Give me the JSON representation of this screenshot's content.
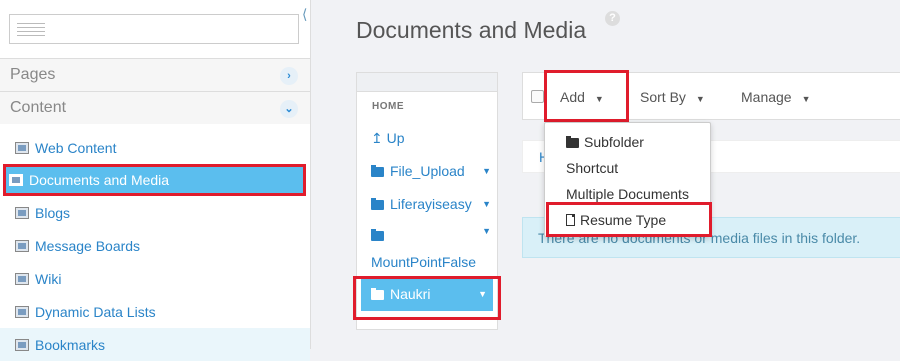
{
  "sidebar": {
    "sections": [
      {
        "label": "Pages",
        "toggle": "›"
      },
      {
        "label": "Content",
        "toggle": "⌄"
      }
    ],
    "items": [
      {
        "label": "Web Content"
      },
      {
        "label": "Documents and Media"
      },
      {
        "label": "Blogs"
      },
      {
        "label": "Message Boards"
      },
      {
        "label": "Wiki"
      },
      {
        "label": "Dynamic Data Lists"
      },
      {
        "label": "Bookmarks"
      }
    ]
  },
  "main": {
    "title": "Documents and Media",
    "help": "?"
  },
  "folders": {
    "home": "HOME",
    "items": [
      {
        "label": "Up",
        "glyph": "↥"
      },
      {
        "label": "File_Upload"
      },
      {
        "label": "Liferayiseasy"
      },
      {
        "label": "MountPointFalse"
      },
      {
        "label": "Naukri"
      }
    ],
    "caret": "▼"
  },
  "toolbar": {
    "add_label": "Add",
    "sort_label": "Sort By",
    "manage_label": "Manage",
    "caret": "▼"
  },
  "add_menu": {
    "items": [
      {
        "label": "Subfolder"
      },
      {
        "label": "Shortcut"
      },
      {
        "label": "Multiple Documents"
      },
      {
        "label": "Resume Type"
      }
    ]
  },
  "breadcrumb": {
    "first": "H"
  },
  "alert": {
    "text": "There are no documents or media files in this folder."
  },
  "colors": {
    "accent": "#5bbeee",
    "link": "#2a84c8",
    "highlight": "#e01c2c"
  }
}
